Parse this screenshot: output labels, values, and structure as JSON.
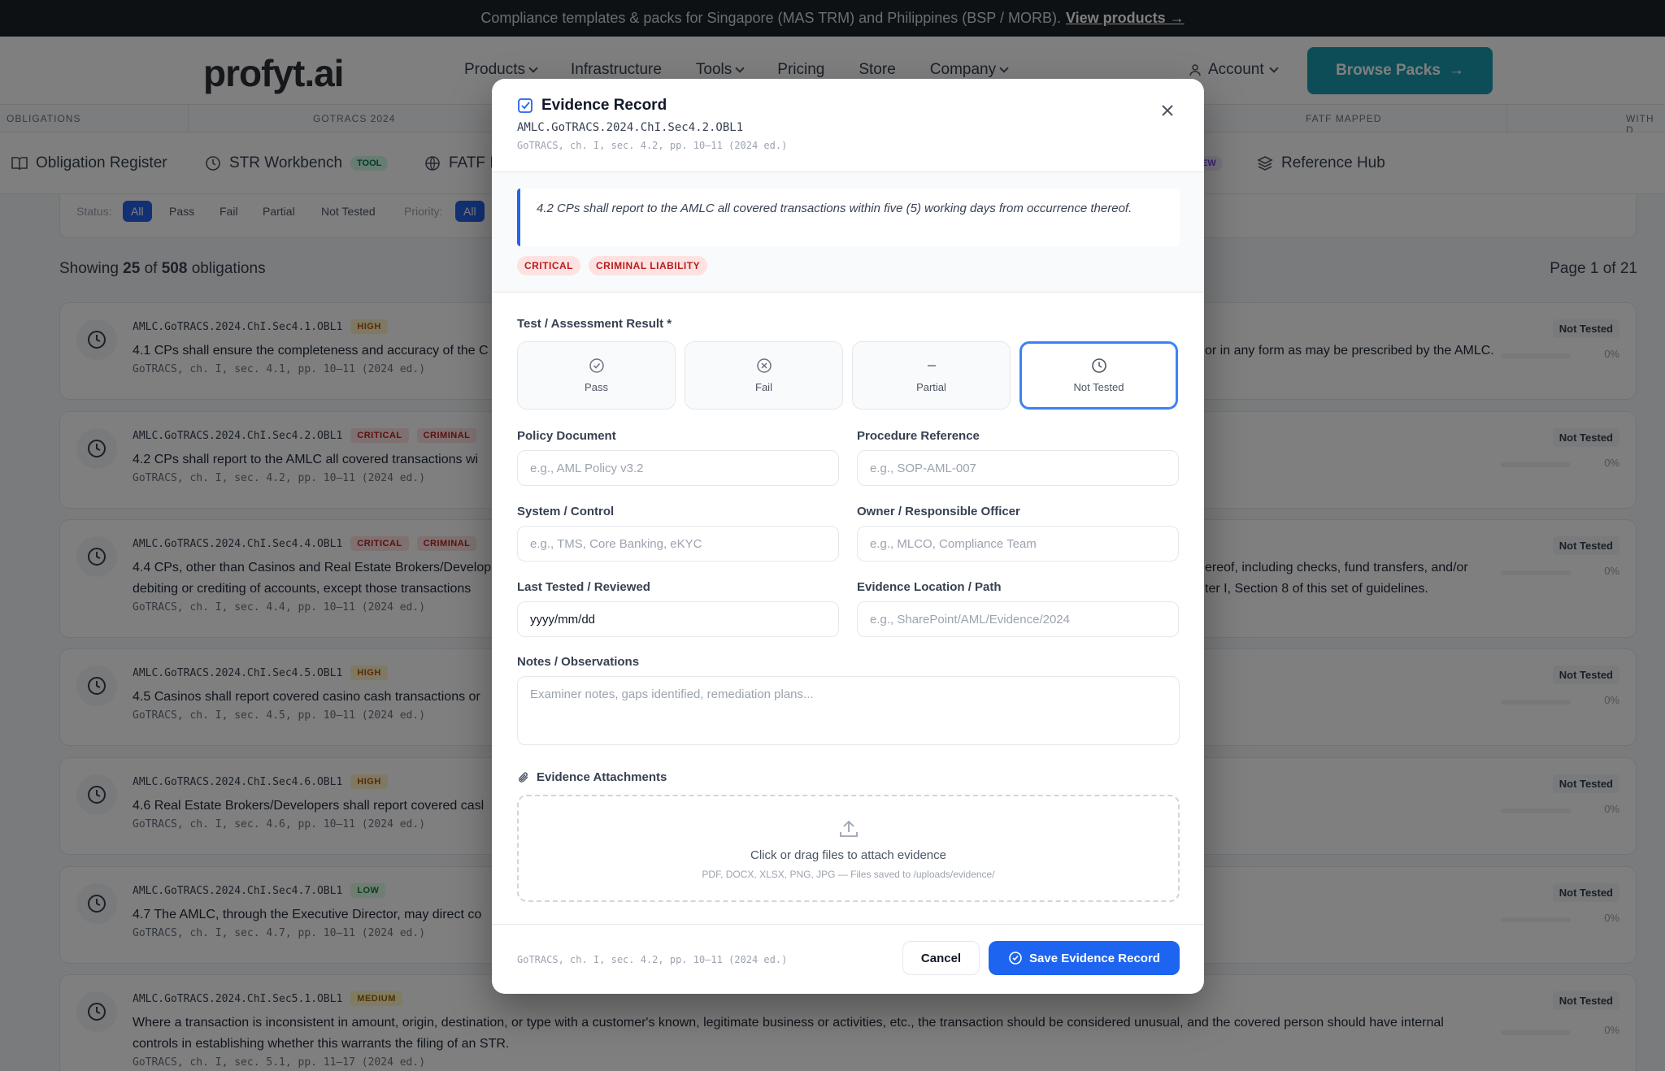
{
  "announcement": {
    "text": "Compliance templates & packs for Singapore (MAS TRM) and Philippines (BSP / MORB).",
    "link": "View products →"
  },
  "header": {
    "logo": "profyt.ai",
    "nav": [
      "Products",
      "Infrastructure",
      "Tools",
      "Pricing",
      "Store",
      "Company"
    ],
    "account": "Account",
    "cta": "Browse Packs"
  },
  "strip": {
    "items": [
      "OBLIGATIONS",
      "GOTRACS 2024",
      "FATF MAPPED",
      "WITH D"
    ]
  },
  "tabs": [
    {
      "label": "Obligation Register",
      "icon": "book-icon"
    },
    {
      "label": "STR Workbench",
      "badge": "TOOL",
      "icon": "clock-icon"
    },
    {
      "label": "FATF I",
      "icon": "globe-icon"
    },
    {
      "label": "",
      "badge": "EW"
    },
    {
      "label": "Reference Hub",
      "icon": "layers-icon"
    }
  ],
  "filters": {
    "status_label": "Status:",
    "status_options": [
      "All",
      "Pass",
      "Fail",
      "Partial",
      "Not Tested"
    ],
    "priority_label": "Priority:",
    "priority_options": [
      "All"
    ]
  },
  "summary": {
    "showing_prefix": "Showing",
    "shown": "25",
    "of": "of",
    "total": "508",
    "suffix": "obligations",
    "page": "Page 1 of 21"
  },
  "obligations": [
    {
      "id": "AMLC.GoTRACS.2024.ChI.Sec4.1.OBL1",
      "tags": [
        "HIGH"
      ],
      "text": "4.1 CPs shall ensure the completeness and accuracy of the C",
      "text_right": "or in any form as may be prescribed by the AMLC.",
      "cite": "GoTRACS, ch. I, sec. 4.1, pp. 10–11 (2024 ed.)",
      "status": "Not Tested",
      "progress": "0%"
    },
    {
      "id": "AMLC.GoTRACS.2024.ChI.Sec4.2.OBL1",
      "tags": [
        "CRITICAL",
        "CRIMINAL"
      ],
      "text": "4.2 CPs shall report to the AMLC all covered transactions wi",
      "text_right": "",
      "cite": "GoTRACS, ch. I, sec. 4.2, pp. 10–11 (2024 ed.)",
      "status": "Not Tested",
      "progress": "0%"
    },
    {
      "id": "AMLC.GoTRACS.2024.ChI.Sec4.4.OBL1",
      "tags": [
        "CRITICAL",
        "CRIMINAL"
      ],
      "text": "4.4 CPs, other than Casinos and Real Estate Brokers/Develop",
      "text2": "debiting or crediting of accounts, except those transactions",
      "text_right": "ereof, including checks, fund transfers, and/or",
      "text_right2": "ter I, Section 8 of this set of guidelines.",
      "cite": "GoTRACS, ch. I, sec. 4.4, pp. 10–11 (2024 ed.)",
      "status": "Not Tested",
      "progress": "0%"
    },
    {
      "id": "AMLC.GoTRACS.2024.ChI.Sec4.5.OBL1",
      "tags": [
        "HIGH"
      ],
      "text": "4.5 Casinos shall report covered casino cash transactions or",
      "text_right": "",
      "cite": "GoTRACS, ch. I, sec. 4.5, pp. 10–11 (2024 ed.)",
      "status": "Not Tested",
      "progress": "0%"
    },
    {
      "id": "AMLC.GoTRACS.2024.ChI.Sec4.6.OBL1",
      "tags": [
        "HIGH"
      ],
      "text": "4.6 Real Estate Brokers/Developers shall report covered casl",
      "text_right": "",
      "cite": "GoTRACS, ch. I, sec. 4.6, pp. 10–11 (2024 ed.)",
      "status": "Not Tested",
      "progress": "0%"
    },
    {
      "id": "AMLC.GoTRACS.2024.ChI.Sec4.7.OBL1",
      "tags": [
        "LOW"
      ],
      "text": "4.7 The AMLC, through the Executive Director, may direct co",
      "text_right": "",
      "cite": "GoTRACS, ch. I, sec. 4.7, pp. 10–11 (2024 ed.)",
      "status": "Not Tested",
      "progress": "0%"
    },
    {
      "id": "AMLC.GoTRACS.2024.ChI.Sec5.1.OBL1",
      "tags": [
        "MEDIUM"
      ],
      "text": "Where a transaction is inconsistent in amount, origin, destination, or type with a customer's known, legitimate business or activities, etc., the transaction should be considered unusual, and the covered person should have internal",
      "text2": "controls in establishing whether this warrants the filing of an STR.",
      "text_right": "",
      "cite": "GoTRACS, ch. I, sec. 5.1, pp. 11–17 (2024 ed.)",
      "status": "Not Tested",
      "progress": "0%"
    }
  ],
  "modal": {
    "title": "Evidence Record",
    "obligation_id": "AMLC.GoTRACS.2024.ChI.Sec4.2.OBL1",
    "citation": "GoTRACS, ch. I, sec. 4.2, pp. 10–11 (2024 ed.)",
    "quote": "4.2 CPs shall report to the AMLC all covered transactions within five (5) working days from occurrence thereof.",
    "tags": [
      "CRITICAL",
      "CRIMINAL LIABILITY"
    ],
    "result_label": "Test / Assessment Result *",
    "results": [
      {
        "label": "Pass",
        "icon": "check-circle-icon"
      },
      {
        "label": "Fail",
        "icon": "x-circle-icon"
      },
      {
        "label": "Partial",
        "icon": "minus-icon"
      },
      {
        "label": "Not Tested",
        "icon": "clock-icon",
        "selected": true
      }
    ],
    "fields": {
      "policy_document": {
        "label": "Policy Document",
        "placeholder": "e.g., AML Policy v3.2"
      },
      "procedure_reference": {
        "label": "Procedure Reference",
        "placeholder": "e.g., SOP-AML-007"
      },
      "system_control": {
        "label": "System / Control",
        "placeholder": "e.g., TMS, Core Banking, eKYC"
      },
      "owner": {
        "label": "Owner / Responsible Officer",
        "placeholder": "e.g., MLCO, Compliance Team"
      },
      "last_tested": {
        "label": "Last Tested / Reviewed",
        "value": "yyyy/mm/dd"
      },
      "evidence_location": {
        "label": "Evidence Location / Path",
        "placeholder": "e.g., SharePoint/AML/Evidence/2024"
      },
      "notes": {
        "label": "Notes / Observations",
        "placeholder": "Examiner notes, gaps identified, remediation plans..."
      }
    },
    "attachments": {
      "label": "Evidence Attachments",
      "drop_text": "Click or drag files to attach evidence",
      "hint": "PDF, DOCX, XLSX, PNG, JPG — Files saved to /uploads/evidence/"
    },
    "footer": {
      "citation": "GoTRACS, ch. I, sec. 4.2, pp. 10–11 (2024 ed.)",
      "cancel": "Cancel",
      "save": "Save Evidence Record"
    }
  },
  "colors": {
    "accent": "#1d64f0",
    "cta": "#1a9ab0",
    "critical": "#b91c1c",
    "high": "#b45309"
  }
}
